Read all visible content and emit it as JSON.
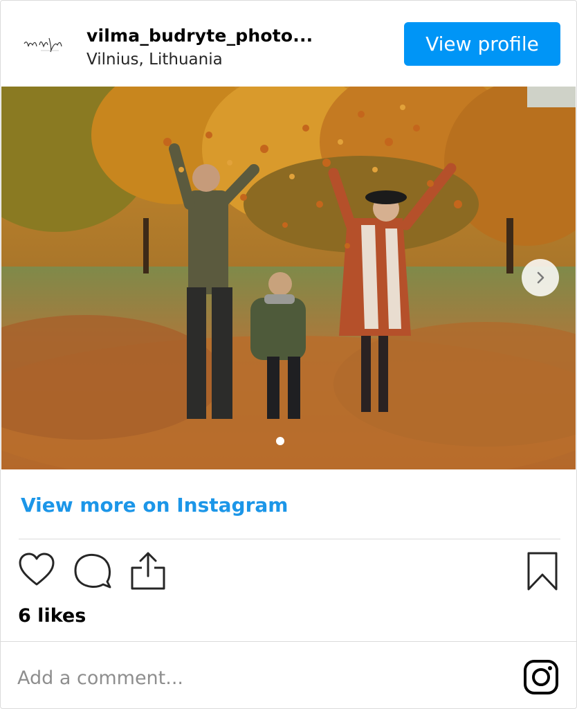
{
  "header": {
    "username": "vilma_budryte_photo...",
    "location": "Vilnius, Lithuania",
    "view_profile_label": "View profile",
    "avatar_text": "Vilma Budryte"
  },
  "post": {
    "view_more_label": "View more on Instagram",
    "likes_text": "6 likes",
    "carousel_position": 1
  },
  "comment": {
    "placeholder": "Add a comment..."
  },
  "icons": {
    "like": "heart-icon",
    "comment": "comment-bubble-icon",
    "share": "share-upload-icon",
    "save": "bookmark-icon",
    "instagram": "instagram-logo-icon",
    "next": "chevron-right-icon"
  },
  "colors": {
    "accent": "#0095f6",
    "link": "#1c96e8",
    "border": "#dbdbdb"
  }
}
